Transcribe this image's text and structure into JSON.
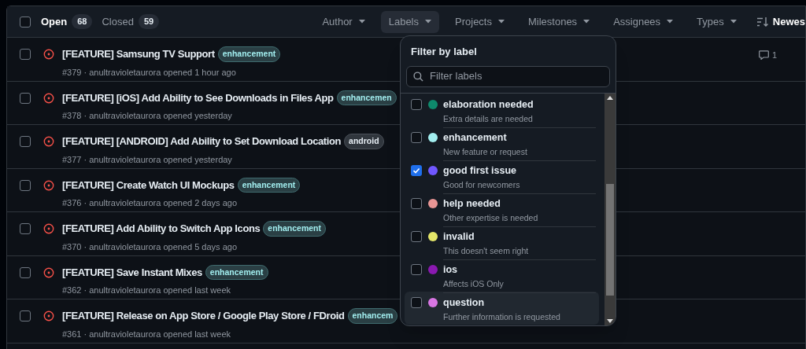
{
  "header": {
    "checked": false,
    "tabs": [
      {
        "label": "Open",
        "count": "68",
        "selected": true
      },
      {
        "label": "Closed",
        "count": "59",
        "selected": false
      }
    ],
    "filters": [
      {
        "label": "Author",
        "selected": false
      },
      {
        "label": "Labels",
        "selected": true
      },
      {
        "label": "Projects",
        "selected": false
      },
      {
        "label": "Milestones",
        "selected": false
      },
      {
        "label": "Assignees",
        "selected": false
      },
      {
        "label": "Types",
        "selected": false
      }
    ],
    "sort": {
      "label": "Newes"
    }
  },
  "issues": [
    {
      "title": "[FEATURE] Samsung TV Support",
      "labels": [
        {
          "name": "enhancement",
          "kind": "enhancement"
        }
      ],
      "meta": "#379 · anultravioletaurora opened 1 hour ago",
      "checked": false,
      "comments": "1"
    },
    {
      "title": "[FEATURE] [iOS] Add Ability to See Downloads in Files App",
      "labels": [
        {
          "name": "enhancemen",
          "kind": "enhancement"
        }
      ],
      "meta": "#378 · anultravioletaurora opened yesterday",
      "checked": false
    },
    {
      "title": "[FEATURE] [ANDROID] Add Ability to Set Download Location",
      "labels": [
        {
          "name": "android",
          "kind": "android"
        }
      ],
      "meta": "#377 · anultravioletaurora opened yesterday",
      "checked": false
    },
    {
      "title": "[FEATURE] Create Watch UI Mockups",
      "labels": [
        {
          "name": "enhancement",
          "kind": "enhancement"
        }
      ],
      "meta": "#376 · anultravioletaurora opened 2 days ago",
      "checked": false
    },
    {
      "title": "[FEATURE] Add Ability to Switch App Icons",
      "labels": [
        {
          "name": "enhancement",
          "kind": "enhancement"
        }
      ],
      "meta": "#370 · anultravioletaurora opened 5 days ago",
      "checked": false
    },
    {
      "title": "[FEATURE] Save Instant Mixes",
      "labels": [
        {
          "name": "enhancement",
          "kind": "enhancement"
        }
      ],
      "meta": "#362 · anultravioletaurora opened last week",
      "checked": false
    },
    {
      "title": "[FEATURE] Release on App Store / Google Play Store / FDroid",
      "labels": [
        {
          "name": "enhancem",
          "kind": "enhancement"
        }
      ],
      "meta": "#361 · anultravioletaurora opened last week",
      "checked": false
    }
  ],
  "label_menu": {
    "title": "Filter by label",
    "search": {
      "placeholder": "Filter labels"
    },
    "items": [
      {
        "name": "elaboration needed",
        "description": "Extra details are needed",
        "color": "#0e8a6c",
        "checked": false,
        "hovered": false
      },
      {
        "name": "enhancement",
        "description": "New feature or request",
        "color": "#a2eeef",
        "checked": false,
        "hovered": false
      },
      {
        "name": "good first issue",
        "description": "Good for newcomers",
        "color": "#7057ff",
        "checked": true,
        "hovered": false
      },
      {
        "name": "help needed",
        "description": "Other expertise is needed",
        "color": "#e99695",
        "checked": false,
        "hovered": false
      },
      {
        "name": "invalid",
        "description": "This doesn't seem right",
        "color": "#e4e669",
        "checked": false,
        "hovered": false
      },
      {
        "name": "ios",
        "description": "Affects iOS Only",
        "color": "#8a19b0",
        "checked": false,
        "hovered": false
      },
      {
        "name": "question",
        "description": "Further information is requested",
        "color": "#d876e3",
        "checked": false,
        "hovered": true
      }
    ]
  }
}
